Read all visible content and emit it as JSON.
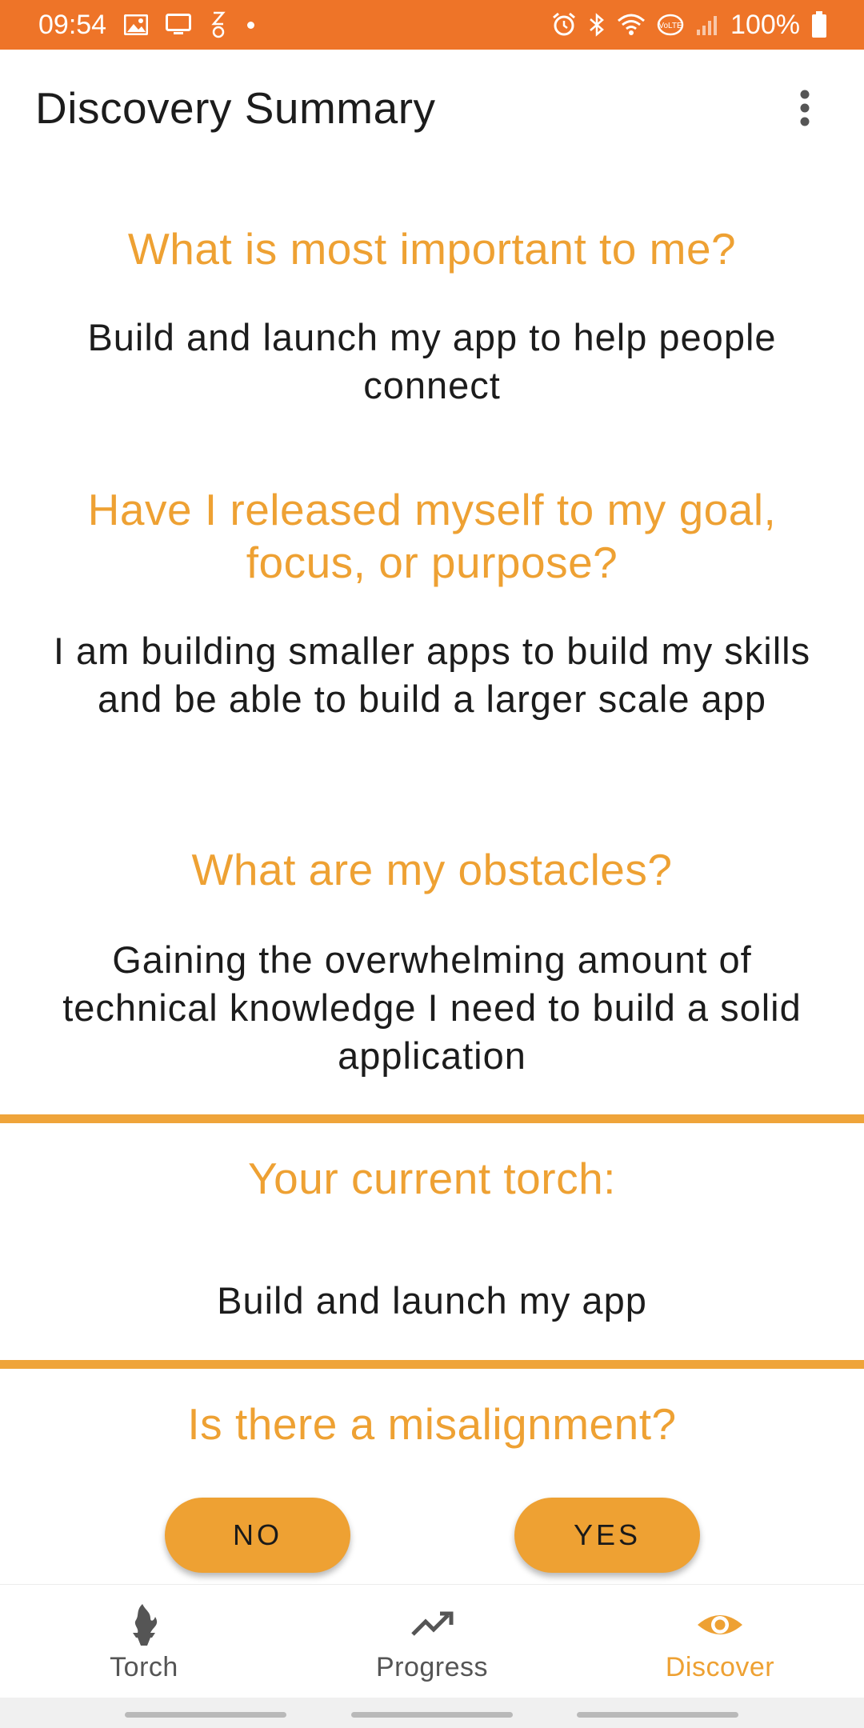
{
  "status_bar": {
    "time": "09:54",
    "battery": "100%",
    "icons_left": [
      "image-icon",
      "cast-screen-icon",
      "sleep-mode-icon"
    ],
    "icons_right": [
      "alarm-icon",
      "bluetooth-icon",
      "wifi-icon",
      "volte-icon",
      "signal-icon",
      "battery-icon"
    ]
  },
  "app_bar": {
    "title": "Discovery Summary",
    "menu_icon": "more-vert-icon"
  },
  "sections": [
    {
      "question": "What is most important to me?",
      "answer": "Build and launch my app to help people connect"
    },
    {
      "question": "Have I released myself to my goal, focus, or purpose?",
      "answer": "I am building smaller apps to build my skills and be able to build a larger scale app"
    },
    {
      "question": "What are my obstacles?",
      "answer": "Gaining the overwhelming amount of technical knowledge I need to build a solid application"
    }
  ],
  "torch": {
    "heading": "Your current torch:",
    "value": "Build and launch my app"
  },
  "misalignment": {
    "question": "Is there a misalignment?",
    "no_label": "NO",
    "yes_label": "YES"
  },
  "bottom_nav": {
    "items": [
      {
        "label": "Torch",
        "icon": "torch-icon"
      },
      {
        "label": "Progress",
        "icon": "trending-up-icon"
      },
      {
        "label": "Discover",
        "icon": "eye-icon"
      }
    ],
    "active": "Discover"
  },
  "colors": {
    "status_bar": "#ee7428",
    "accent": "#eea133",
    "divider": "#efa43a",
    "text": "#1c1c1c"
  }
}
